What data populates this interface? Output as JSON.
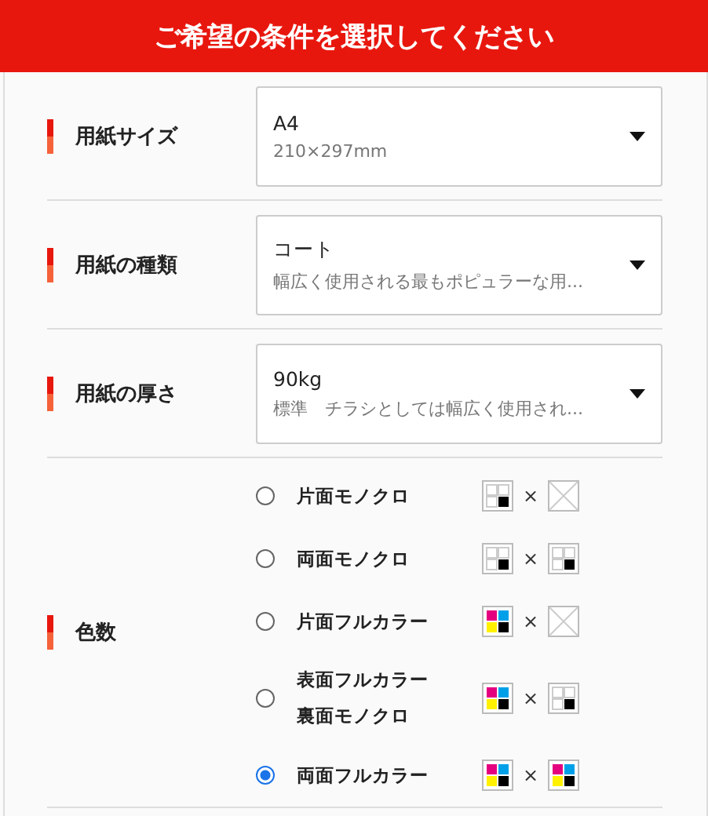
{
  "header": {
    "title": "ご希望の条件を選択してください"
  },
  "selects": [
    {
      "label": "用紙サイズ",
      "value": "A4",
      "description": "210×297mm"
    },
    {
      "label": "用紙の種類",
      "value": "コート",
      "description": "幅広く使用される最もポピュラーな用..."
    },
    {
      "label": "用紙の厚さ",
      "value": "90kg",
      "description": "標準　チラシとしては幅広く使用され..."
    }
  ],
  "colors": {
    "label": "色数",
    "options": [
      {
        "lines": [
          "片面モノクロ"
        ],
        "selected": false,
        "front": {
          "kind": "mono"
        },
        "times": "×",
        "back": {
          "kind": "none"
        }
      },
      {
        "lines": [
          "両面モノクロ"
        ],
        "selected": false,
        "front": {
          "kind": "mono"
        },
        "times": "×",
        "back": {
          "kind": "mono"
        }
      },
      {
        "lines": [
          "片面フルカラー"
        ],
        "selected": false,
        "front": {
          "kind": "color"
        },
        "times": "×",
        "back": {
          "kind": "none"
        }
      },
      {
        "lines": [
          "表面フルカラー",
          "裏面モノクロ"
        ],
        "selected": false,
        "front": {
          "kind": "color"
        },
        "times": "×",
        "back": {
          "kind": "mono"
        }
      },
      {
        "lines": [
          "両面フルカラー"
        ],
        "selected": true,
        "front": {
          "kind": "color"
        },
        "times": "×",
        "back": {
          "kind": "color"
        }
      }
    ]
  }
}
